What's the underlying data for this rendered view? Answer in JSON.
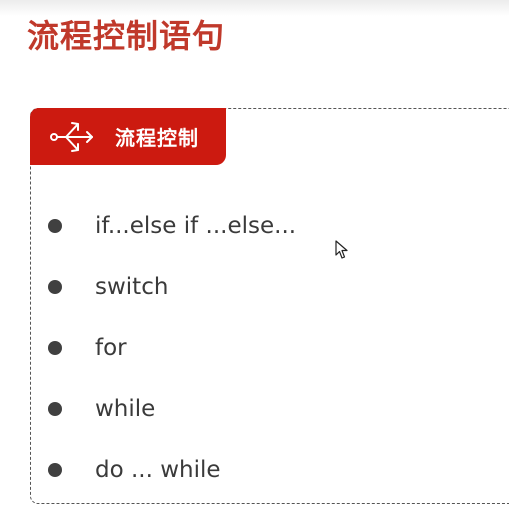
{
  "page": {
    "title": "流程控制语句"
  },
  "section": {
    "label": "流程控制",
    "icon": "branch-arrows-icon",
    "color": "#cc1a10"
  },
  "items": [
    {
      "label": "if...else if ...else..."
    },
    {
      "label": "switch"
    },
    {
      "label": "for"
    },
    {
      "label": "while"
    },
    {
      "label": "do ... while"
    }
  ],
  "colors": {
    "title": "#c0392b",
    "accent": "#cc1a10",
    "text": "#3a3a3a"
  }
}
